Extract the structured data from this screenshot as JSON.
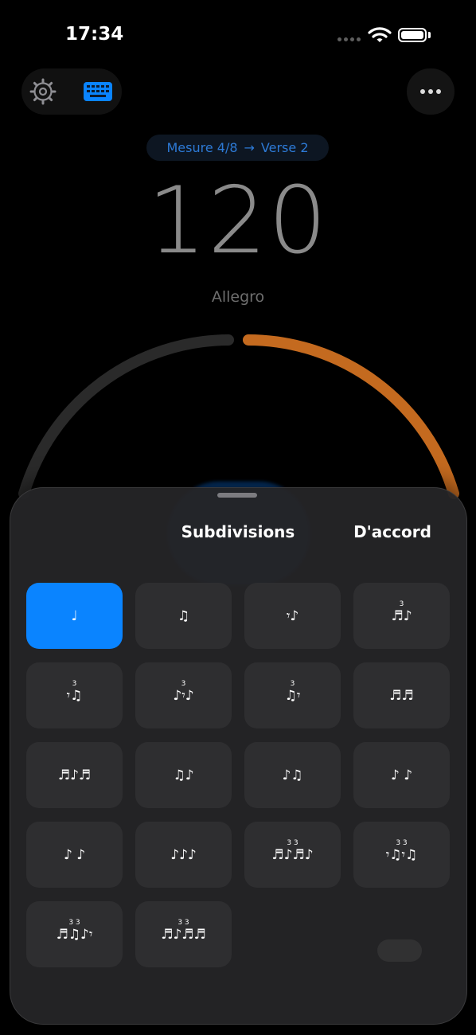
{
  "status": {
    "time": "17:34"
  },
  "header": {
    "measure": "Mesure 4/8",
    "arrow": "→",
    "section": "Verse 2"
  },
  "tempo": {
    "bpm": "120",
    "name": "Allegro"
  },
  "colors": {
    "accent": "#0a84ff",
    "dial_progress": "#c46a1f",
    "chip_text": "#2d7ad6"
  },
  "icons": {
    "settings": "gear-icon",
    "keyboard": "keyboard-icon",
    "more": "ellipsis-icon"
  },
  "sheet": {
    "title": "Subdivisions",
    "done": "D'accord",
    "selected_index": 0,
    "options": [
      {
        "glyph": "♩",
        "tuplet": ""
      },
      {
        "glyph": "♫",
        "tuplet": ""
      },
      {
        "glyph": "𝄾♪",
        "tuplet": ""
      },
      {
        "glyph": "♬♪",
        "tuplet": "3"
      },
      {
        "glyph": "𝄾♫",
        "tuplet": "3"
      },
      {
        "glyph": "♪𝄾♪",
        "tuplet": "3"
      },
      {
        "glyph": "♫𝄾",
        "tuplet": "3"
      },
      {
        "glyph": "♬♬",
        "tuplet": ""
      },
      {
        "glyph": "♬♪♬",
        "tuplet": ""
      },
      {
        "glyph": "♫♪",
        "tuplet": ""
      },
      {
        "glyph": "♪♫",
        "tuplet": ""
      },
      {
        "glyph": "♪ ♪",
        "tuplet": ""
      },
      {
        "glyph": "♪ ♪",
        "tuplet": ""
      },
      {
        "glyph": "♪♪♪",
        "tuplet": ""
      },
      {
        "glyph": "♬♪♬♪",
        "tuplet": "3  3"
      },
      {
        "glyph": "𝄾♫𝄾♫",
        "tuplet": "3  3"
      },
      {
        "glyph": "♬♫♪𝄾",
        "tuplet": "3  3"
      },
      {
        "glyph": "♬♪♬♬",
        "tuplet": "3  3"
      }
    ]
  }
}
